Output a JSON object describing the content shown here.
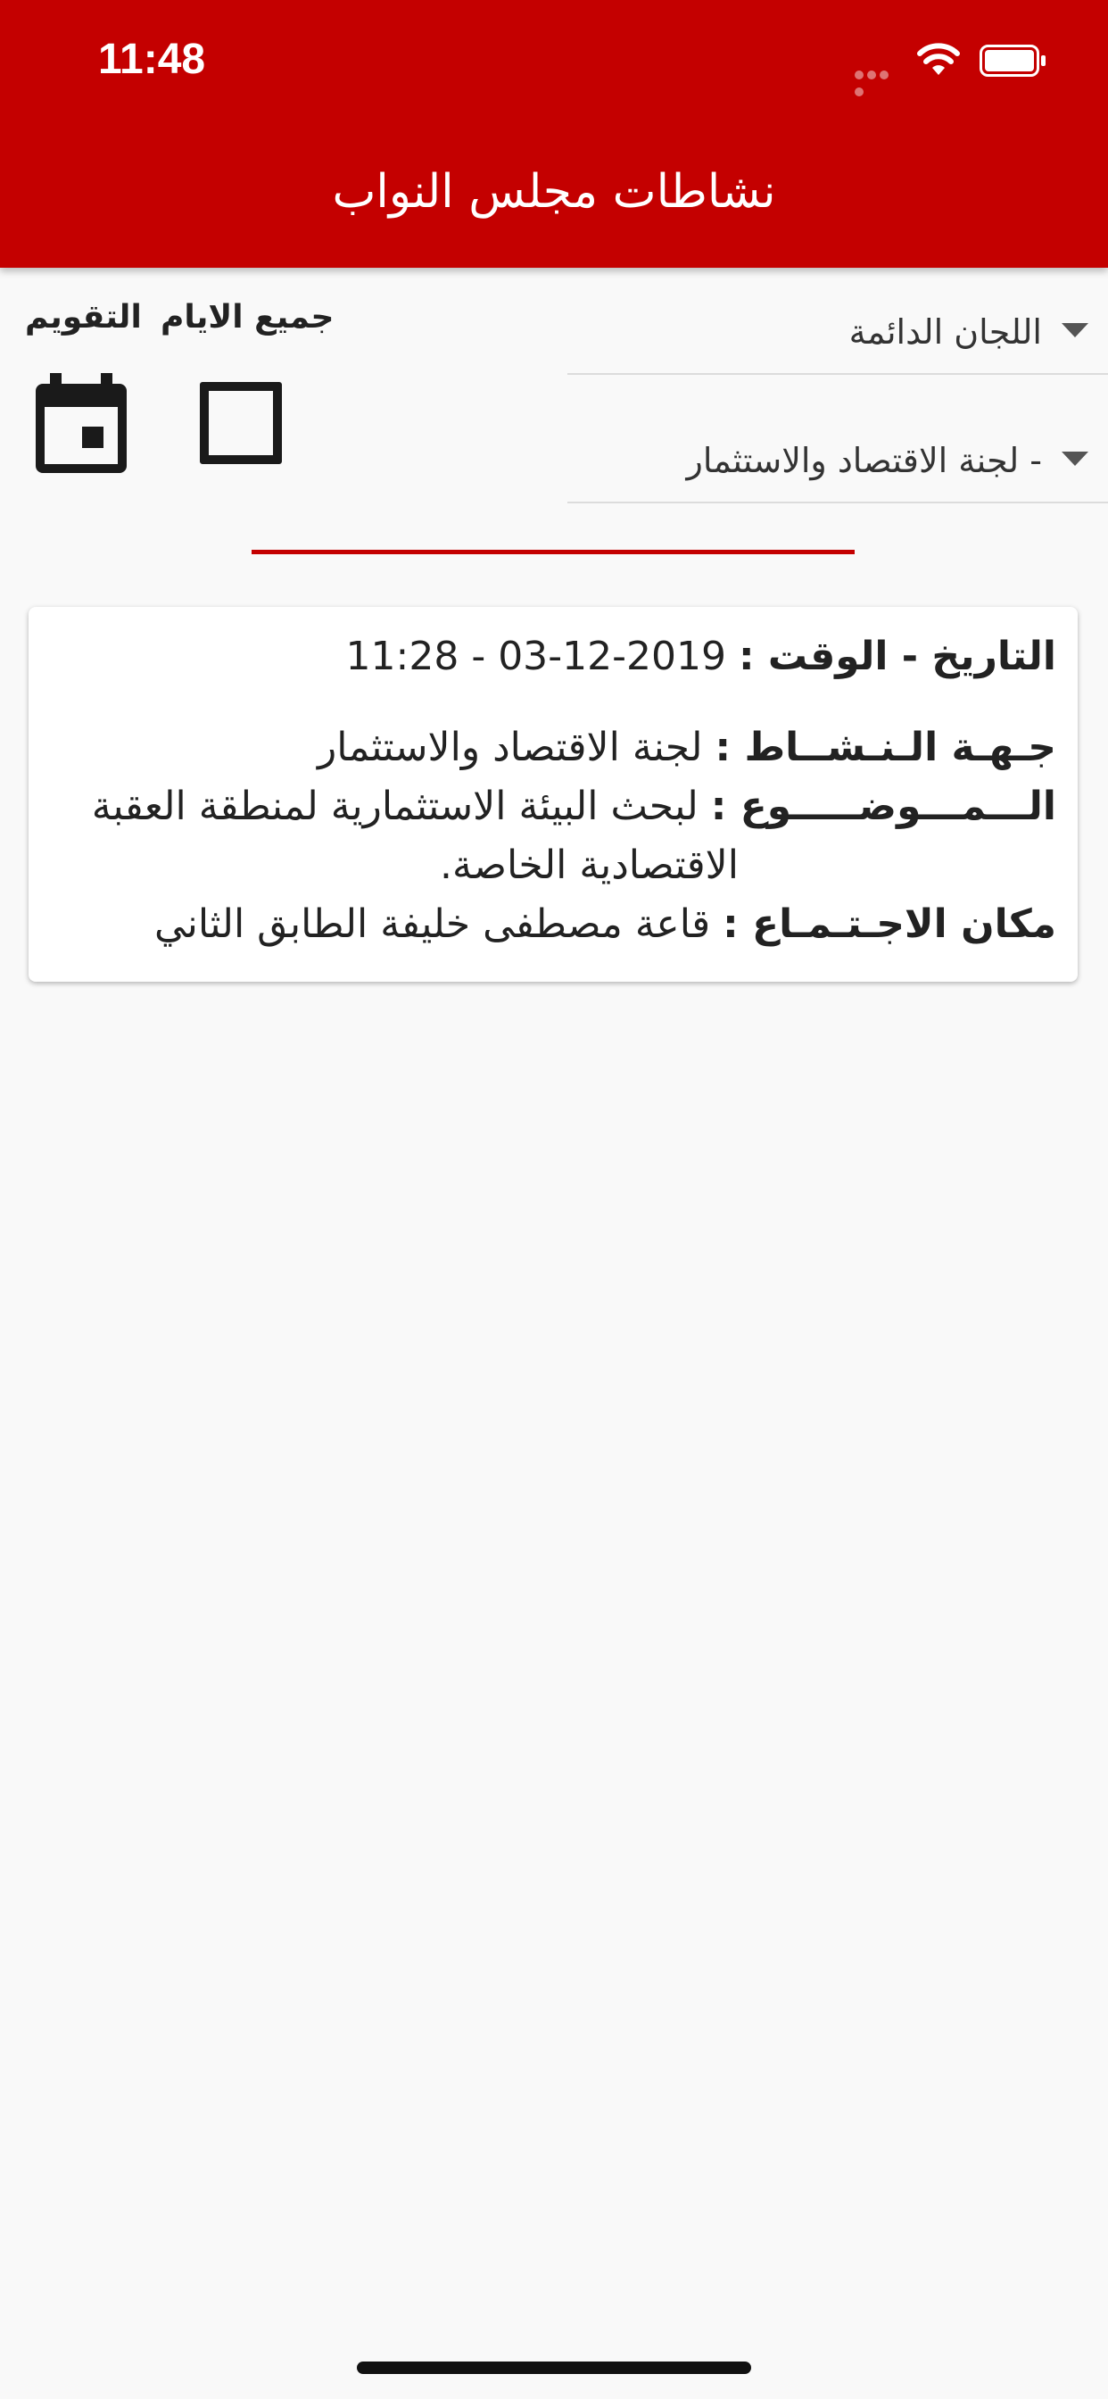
{
  "status_bar": {
    "time": "11:48",
    "icons": [
      "signal-dots-icon",
      "wifi-icon",
      "battery-icon"
    ]
  },
  "header": {
    "title": "نشاطات مجلس النواب"
  },
  "filters": {
    "committee_type": "اللجان الدائمة",
    "committee": "- لجنة الاقتصاد والاستثمار",
    "calendar_label": "التقويم",
    "all_days_label": "جميع الايام",
    "all_days_checked": false
  },
  "activities": [
    {
      "date_label": "التاريخ - الوقت :",
      "date_value": "2019-12-03 - 11:28",
      "entity_label": "جـهـة الـنـشــاط :",
      "entity_value": "لجنة الاقتصاد والاستثمار",
      "subject_label": "الـــمـــوضـــــوع :",
      "subject_value": "لبحث البيئة الاستثمارية لمنطقة العقبة",
      "subject_value_cont": "الاقتصادية الخاصة.",
      "venue_label": "مكان الاجـتـمـاع :",
      "venue_value": "قاعة مصطفى خليفة الطابق الثاني"
    }
  ],
  "colors": {
    "primary": "#c40000",
    "background": "#f9f9f9",
    "card": "#ffffff",
    "text": "#222222"
  }
}
